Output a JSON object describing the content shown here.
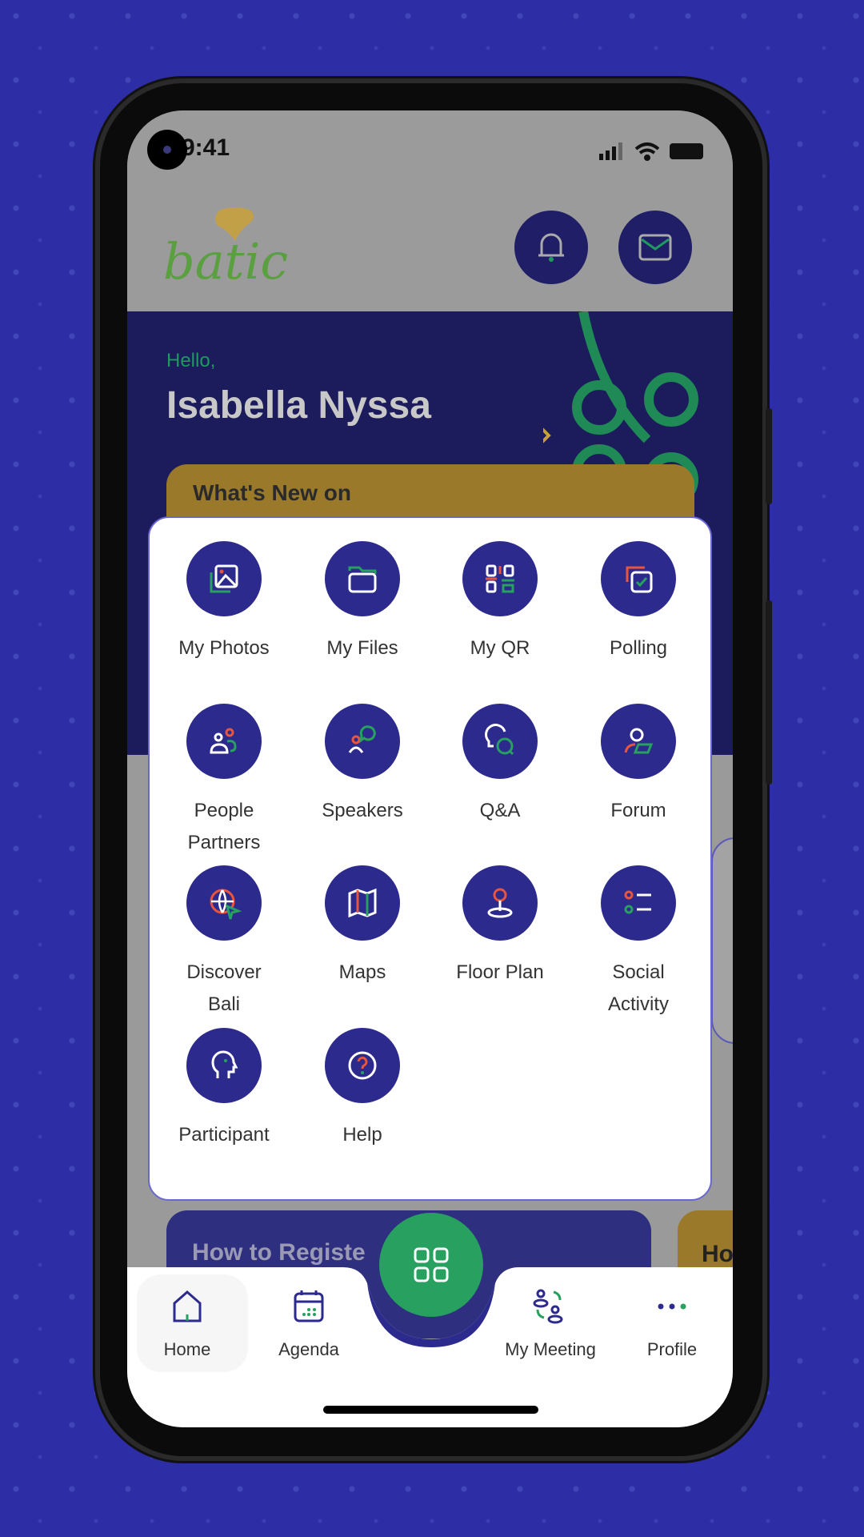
{
  "status_bar": {
    "time": "9:41"
  },
  "header": {
    "logo_text": "batic",
    "notification_icon": "bell-icon",
    "message_icon": "mail-icon"
  },
  "banner": {
    "greeting": "Hello,",
    "user_name": "Isabella Nyssa",
    "card_title": "What's New on"
  },
  "menu": {
    "items": [
      {
        "label": "My Photos",
        "icon": "photos-icon"
      },
      {
        "label": "My Files",
        "icon": "folder-icon"
      },
      {
        "label": "My QR",
        "icon": "qr-icon"
      },
      {
        "label": "Polling",
        "icon": "polling-icon"
      },
      {
        "label": "People\nPartners",
        "line1": "People",
        "line2": "Partners",
        "icon": "people-icon"
      },
      {
        "label": "Speakers",
        "icon": "speakers-icon"
      },
      {
        "label": "Q&A",
        "icon": "qa-icon"
      },
      {
        "label": "Forum",
        "icon": "forum-icon"
      },
      {
        "label": "Discover Bali",
        "line1": "Discover",
        "line2": "Bali",
        "icon": "globe-icon"
      },
      {
        "label": "Maps",
        "icon": "map-icon"
      },
      {
        "label": "Floor Plan",
        "icon": "pin-icon"
      },
      {
        "label": "Social Activity",
        "line1": "Social",
        "line2": "Activity",
        "icon": "list-icon"
      },
      {
        "label": "Participant",
        "icon": "participant-icon"
      },
      {
        "label": "Help",
        "icon": "help-icon"
      }
    ]
  },
  "background_cards": {
    "how_to": "How to Registe",
    "right_card": "Ho"
  },
  "bottom_nav": {
    "items": [
      {
        "label": "Home",
        "icon": "home-icon",
        "active": true
      },
      {
        "label": "Agenda",
        "icon": "calendar-icon"
      },
      {
        "label": "My Meeting",
        "icon": "meeting-icon"
      },
      {
        "label": "Profile",
        "icon": "more-icon"
      }
    ],
    "fab_icon": "grid-icon"
  },
  "colors": {
    "primary": "#2c2a8c",
    "accent_green": "#27a060",
    "accent_red": "#e8553e",
    "gold": "#c9a13a",
    "background": "#2d2ea6"
  }
}
